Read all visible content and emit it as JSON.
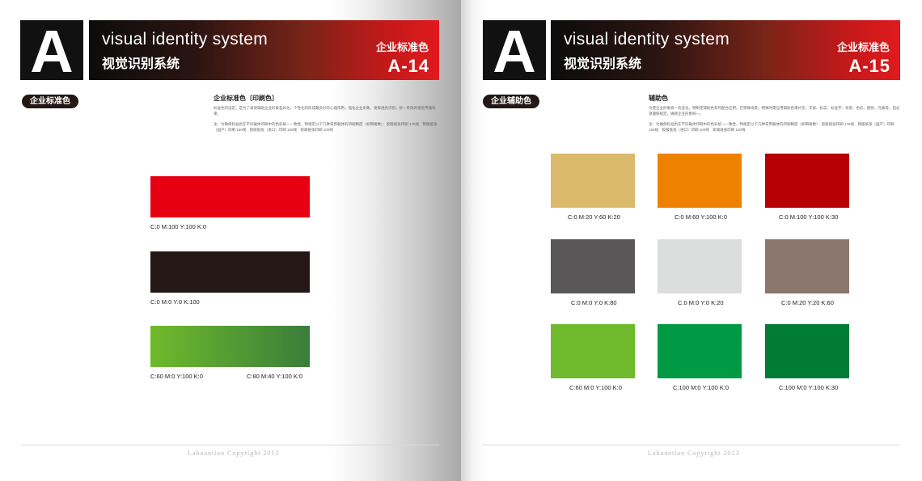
{
  "brand": {
    "letter": "A",
    "title_en": "visual identity system",
    "title_cn": "视觉识别系统"
  },
  "left": {
    "banner_label": "企业标准色",
    "page_code": "A-14",
    "section_tab": "企业标准色",
    "desc_title": "企业标准色〔印刷色〕",
    "desc_body": "标准色的设定，是为了表现辅助企业形象差异化，个性化的形成最良好的心理作用，强化企业形象，发挥视觉识别，统一有效的视觉传播效果。",
    "desc_note": "注：为确保标准色在不同载体印刷中的色彩统一一致性，特规定以下几种常用载体的印刷精度（如网格数）：胶版纸张印刷 175线　铜版纸张（国产）印刷 150线　胶版纸张（进口）印刷 100线　新闻纸张印刷 100线",
    "swatches": [
      {
        "color": "#e60012",
        "label": "C:0  M:100  Y:100  K:0"
      },
      {
        "color": "#231815",
        "label": "C:0  M:0  Y:0  K:100"
      },
      {
        "color_from": "#6fba2c",
        "color_to": "#3a7d3b",
        "label_left": "C:60  M:0  Y:100  K:0",
        "label_right": "C:80  M:40  Y:100  K:0"
      }
    ],
    "footer": "Lahuantian Copyright 2013"
  },
  "right": {
    "banner_label": "企业标准色",
    "page_code": "A-15",
    "section_tab": "企业辅助色",
    "desc_title": "辅助色",
    "desc_body": "为使企业形象统一有变化，特制定辅助色系列配合应用。在特殊场景，特殊时需应用辅助色来补充、丰富、标志、标准字、背景、色彩、图形、元素等，但必须遵照规定，确保企业形象统一。",
    "desc_note": "注：为确保标准色在不同载体印刷中的色彩统一一致性，特规定以下几种常用载体的印刷精度（如网格数）：胶版纸张印刷 175线　铜版纸张（国产）印刷 150线　胶版纸张（进口）印刷 100线　新闻纸张印刷 100线",
    "swatches": [
      {
        "color": "#dbb96a",
        "label": "C:0  M:20  Y:60  K:20"
      },
      {
        "color": "#ee8200",
        "label": "C:0  M:60  Y:100  K:0"
      },
      {
        "color": "#b60005",
        "label": "C:0  M:100  Y:100  K:30"
      },
      {
        "color": "#595757",
        "label": "C:0  M:0  Y:0  K:80"
      },
      {
        "color": "#dcdddd",
        "label": "C:0  M:0  Y:0  K:20"
      },
      {
        "color": "#8a766c",
        "label": "C:0  M:20  Y:20  K:60"
      },
      {
        "color": "#6fba2c",
        "label": "C:60  M:0  Y:100  K:0"
      },
      {
        "color": "#009a44",
        "label": "C:100  M:0  Y:100  K:0"
      },
      {
        "color": "#007c36",
        "label": "C:100  M:0  Y:100  K:30"
      }
    ],
    "footer": "Lahuantian Copyright 2013"
  }
}
